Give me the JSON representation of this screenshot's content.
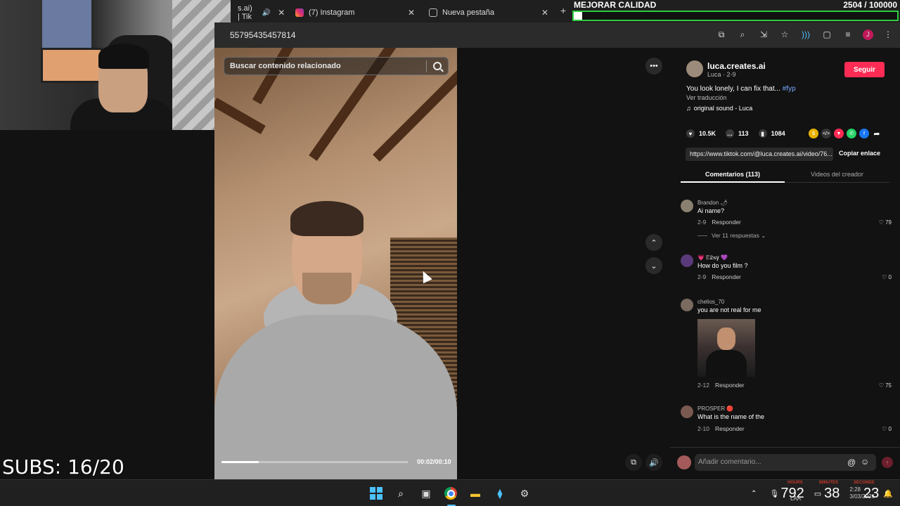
{
  "browser": {
    "tabs": [
      {
        "label": "s.ai) | Tik"
      },
      {
        "label": "(7) Instagram"
      },
      {
        "label": "Nueva pestaña"
      }
    ],
    "url": "55795435457814",
    "close_glyph": "✕",
    "new_tab_glyph": "+",
    "toolbar_icons": [
      "translate-icon",
      "zoom-icon",
      "install-icon",
      "star-icon",
      "extension-icon",
      "puzzle-icon",
      "media-icon",
      "profile-avatar",
      "menu-icon"
    ],
    "profile_initial": "J"
  },
  "overlay": {
    "title": "MEJORAR CALIDAD",
    "count": "2504 / 100000",
    "progress_fraction": 0.025,
    "bar_color": "#2ecc40"
  },
  "stream": {
    "subs_label": "SUBS: 16/20"
  },
  "video": {
    "search_placeholder": "Buscar contenido relacionado",
    "time": "00:02/00:10",
    "progress_fraction": 0.2,
    "more_glyph": "•••"
  },
  "post": {
    "username": "luca.creates.ai",
    "subline": "Luca · 2-9",
    "follow_label": "Seguir",
    "follow_color": "#fe2c55",
    "description": "You look lonely, I can fix that... ",
    "hashtag": "#fyp",
    "translate_label": "Ver traducción",
    "sound": "original sound - Luca",
    "likes": "10.5K",
    "comments_count": "113",
    "saves": "1084",
    "share_icons": [
      "coin-icon",
      "embed-icon",
      "send-icon",
      "whatsapp-icon",
      "facebook-icon",
      "share-arrow-icon"
    ],
    "link": "https://www.tiktok.com/@luca.creates.ai/video/76...",
    "copy_label": "Copiar enlace",
    "tab_comments": "Comentarios (113)",
    "tab_creator": "Videos del creador"
  },
  "comments": [
    {
      "name": "Brandon 🌶",
      "text": "Ai name?",
      "date": "2-9",
      "reply": "Responder",
      "likes": "79",
      "replies_label": "Ver 11 respuestas ⌄"
    },
    {
      "name": "💗 E𝟐𝐬𝐲 💜",
      "text": "How do you film ?",
      "date": "2-9",
      "reply": "Responder",
      "likes": "0"
    },
    {
      "name": "chelios_70",
      "text": "you are not real for me",
      "date": "2-12",
      "reply": "Responder",
      "likes": "75"
    },
    {
      "name": "PROSPER 🔴",
      "text": "What is the name of the",
      "date": "2-10",
      "reply": "Responder",
      "likes": "0"
    }
  ],
  "add_comment": {
    "placeholder": "Añadir comentario..."
  },
  "taskbar": {
    "icons": [
      "windows-logo",
      "search-icon",
      "task-view-icon",
      "chrome-icon",
      "file-explorer-icon",
      "app-icon",
      "steam-icon"
    ],
    "tray": {
      "hours_label": "HOURS",
      "minutes_label": "MINUTES",
      "seconds_label": "SECONDS",
      "hours": "792",
      "minutes": "38",
      "seconds": "23",
      "time": "2:28",
      "date": "3/03/2026",
      "lang": "LAA"
    }
  }
}
